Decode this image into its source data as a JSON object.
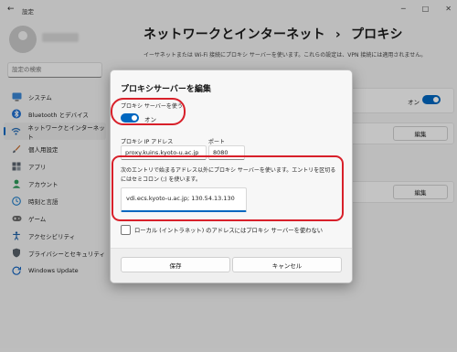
{
  "window": {
    "title": "設定",
    "back_glyph": "←",
    "min_glyph": "─",
    "max_glyph": "□",
    "close_glyph": "✕"
  },
  "search": {
    "placeholder": "設定の検索"
  },
  "sidebar": {
    "items": [
      {
        "label": "システム",
        "icon": "monitor-icon",
        "color": "#0067c0"
      },
      {
        "label": "Bluetooth とデバイス",
        "icon": "bluetooth-icon",
        "color": "#1f6fd0"
      },
      {
        "label": "ネットワークとインターネット",
        "icon": "wifi-icon",
        "color": "#2a6fb7",
        "active": true
      },
      {
        "label": "個人用設定",
        "icon": "brush-icon",
        "color": "#c46a2b"
      },
      {
        "label": "アプリ",
        "icon": "apps-icon",
        "color": "#5b6470"
      },
      {
        "label": "アカウント",
        "icon": "account-icon",
        "color": "#2d9a5a"
      },
      {
        "label": "時刻と言語",
        "icon": "globe-clock-icon",
        "color": "#1c7bc8"
      },
      {
        "label": "ゲーム",
        "icon": "gamepad-icon",
        "color": "#6b6b6b"
      },
      {
        "label": "アクセシビリティ",
        "icon": "accessibility-icon",
        "color": "#2163a8"
      },
      {
        "label": "プライバシーとセキュリティ",
        "icon": "shield-icon",
        "color": "#58606a"
      },
      {
        "label": "Windows Update",
        "icon": "windows-update-icon",
        "color": "#1565c0"
      }
    ]
  },
  "page": {
    "breadcrumb_parent": "ネットワークとインターネット",
    "breadcrumb_sep": "›",
    "breadcrumb_current": "プロキシ",
    "description": "イーサネットまたは Wi-Fi 接続にプロキシ サーバーを使います。これらの設定は、VPN 接続には適用されません。",
    "auto_detect_state": "オン",
    "edit_label_1": "編集",
    "edit_label_2": "編集"
  },
  "dialog": {
    "title": "プロキシサーバーを編集",
    "use_proxy_label": "プロキシ サーバーを使う",
    "use_proxy_state": "オン",
    "ip_label": "プロキシ IP アドレス",
    "ip_value": "proxy.kuins.kyoto-u.ac.jp",
    "port_label": "ポート",
    "port_value": "8080",
    "exclusion_description": "次のエントリで始まるアドレス以外にプロキシ サーバーを使います。エントリを区切るにはセミコロン (;) を使います。",
    "exclusion_value": "vdi.ecs.kyoto-u.ac.jp; 130.54.13.130",
    "local_checkbox_label": "ローカル (イントラネット) のアドレスにはプロキシ サーバーを使わない",
    "local_checkbox_checked": false,
    "save_label": "保存",
    "cancel_label": "キャンセル"
  },
  "colors": {
    "accent": "#0067c0",
    "highlight": "#d8202a"
  }
}
